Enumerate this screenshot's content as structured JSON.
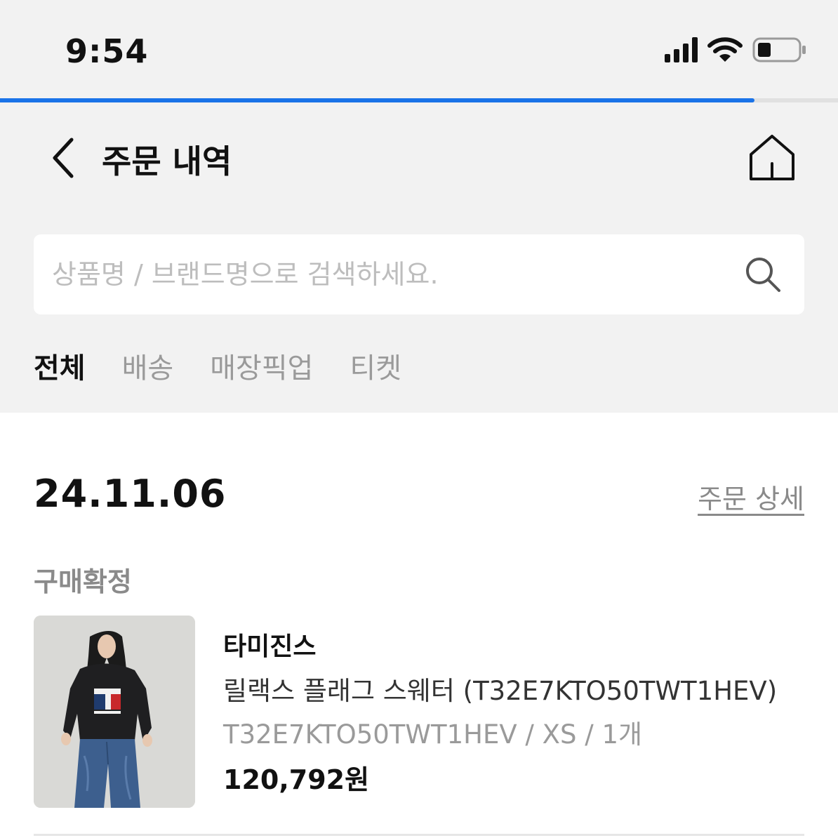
{
  "status_bar": {
    "time": "9:54",
    "icons": [
      "cellular-signal-icon",
      "wifi-icon",
      "battery-icon"
    ]
  },
  "loading_progress": 0.9,
  "header": {
    "title": "주문 내역",
    "back_icon": "chevron-left-icon",
    "home_icon": "home-icon"
  },
  "search": {
    "placeholder": "상품명 / 브랜드명으로 검색하세요.",
    "value": "",
    "icon": "search-icon"
  },
  "tabs": [
    {
      "label": "전체",
      "active": true
    },
    {
      "label": "배송",
      "active": false
    },
    {
      "label": "매장픽업",
      "active": false
    },
    {
      "label": "티켓",
      "active": false
    }
  ],
  "order": {
    "date": "24.11.06",
    "detail_link": "주문 상세",
    "status": "구매확정",
    "item": {
      "brand": "타미진스",
      "name": "릴랙스 플래그 스웨터 (T32E7KTO50TWT1HEV)",
      "option": "T32E7KTO50TWT1HEV / XS / 1개",
      "price": "120,792원"
    }
  },
  "colors": {
    "accent": "#1a73e8",
    "background_top": "#f2f2f2",
    "text_primary": "#111111",
    "text_muted": "#9a9a9a"
  }
}
